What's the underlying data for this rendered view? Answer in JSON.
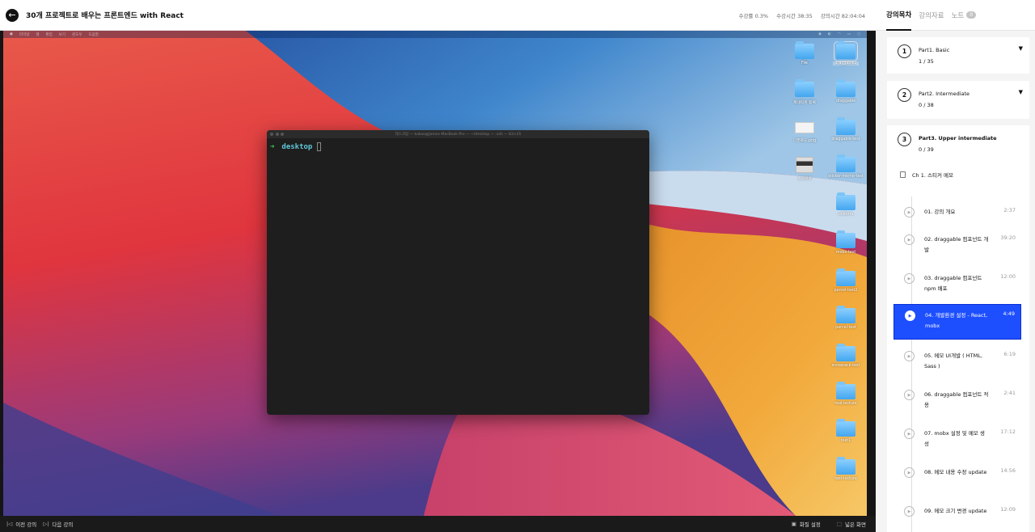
{
  "header": {
    "title": "30개 프로젝트로 배우는 프론트엔드 with React",
    "progress": "수강률 0.3%",
    "watch_time": "수강시간 38:35",
    "lecture_time": "강의시간 82:04:04"
  },
  "video": {
    "mac_menu": [
      "터미널",
      "셸",
      "편집",
      "보기",
      "윈도우",
      "도움말"
    ],
    "terminal": {
      "title": "데스크탑 — kakao@James-MacBook-Pro — ~/desktop — -zsh — 83×35",
      "prompt_arrow": "➜",
      "prompt_dir": "desktop"
    },
    "desktop_icons": [
      "File",
      "draggable2",
      "제네릭원 등록",
      "draggable",
      "다운로드.png",
      "draggable-test",
      "스크린샷",
      "sticker-memo-test",
      "uniform",
      "mobx-test",
      "parcel-test2",
      "parcel-test",
      "snowpack-test",
      "real-lecture",
      "test1",
      "test-lecture"
    ]
  },
  "footer": {
    "prev": "이전 강의",
    "next": "다음 강의",
    "quality": "화질 설정",
    "wide": "넓은 화면"
  },
  "sidebar": {
    "tabs": [
      {
        "label": "강의목차"
      },
      {
        "label": "강의자료"
      },
      {
        "label": "노트",
        "badge": "0"
      }
    ],
    "parts": [
      {
        "num": "1",
        "title": "Part1. Basic",
        "progress": "1 / 35"
      },
      {
        "num": "2",
        "title": "Part2. Intermediate",
        "progress": "0 / 38"
      },
      {
        "num": "3",
        "title": "Part3. Upper intermediate",
        "progress": "0 / 39"
      }
    ],
    "chapter": "Ch 1. 스티커 메모",
    "lessons": [
      {
        "title": "01. 강의 개요",
        "duration": "2:37"
      },
      {
        "title": "02. draggable 컴포넌트 개발",
        "duration": "39:20"
      },
      {
        "title": "03. draggable 컴포넌트 npm 배포",
        "duration": "12:00"
      },
      {
        "title": "04. 개발환경 설정 - React, mobx",
        "duration": "4:49"
      },
      {
        "title": "05. 메모 UI개발 ( HTML, Sass )",
        "duration": "6:19"
      },
      {
        "title": "06. draggable 컴포넌트 적용",
        "duration": "2:41"
      },
      {
        "title": "07. mobx 설정 및 메모 생성",
        "duration": "17:12"
      },
      {
        "title": "08. 메모 내용 수정 update",
        "duration": "14:56"
      },
      {
        "title": "09. 메모 크기 변경 update",
        "duration": "12:09"
      }
    ],
    "active_lesson_index": 3
  },
  "colors": {
    "accent": "#1d4fff",
    "terminal_bg": "#1e1e1e",
    "prompt_arrow": "#39d353",
    "prompt_dir": "#5fc8d8"
  },
  "icons": {
    "back": "arrow-left-icon",
    "chevron": "chevron-down-icon",
    "play": "play-circle-icon",
    "prev": "skip-previous-icon",
    "next": "skip-next-icon",
    "quality": "quality-icon",
    "wide": "widescreen-icon"
  }
}
